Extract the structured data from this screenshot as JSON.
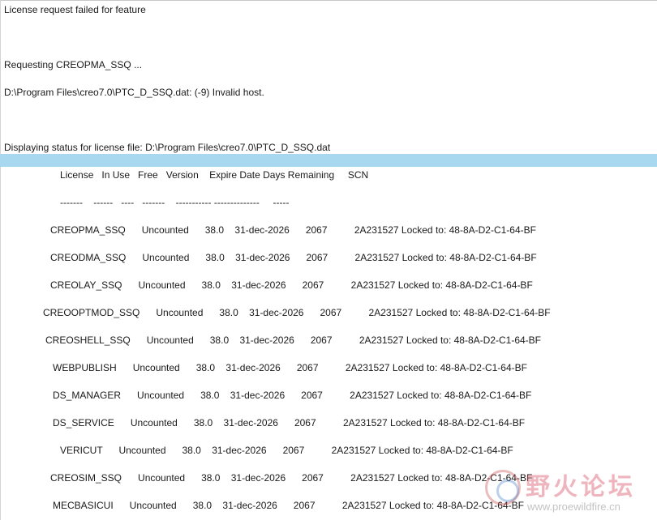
{
  "log": {
    "line1": "License request failed for feature",
    "line2": "Requesting CREOPMA_SSQ ...",
    "line3": "D:\\Program Files\\creo7.0\\PTC_D_SSQ.dat: (-9) Invalid host.",
    "line4": "Displaying status for license file: D:\\Program Files\\creo7.0\\PTC_D_SSQ.dat"
  },
  "table": {
    "header": "License   In Use   Free   Version    Expire Date Days Remaining     SCN",
    "separator": "-------    ------   ----   -------    ----------- --------------     -----",
    "rows": [
      "CREOPMA_SSQ      Uncounted      38.0    31-dec-2026      2067          2A231527 Locked to: 48-8A-D2-C1-64-BF",
      "CREODMA_SSQ      Uncounted      38.0    31-dec-2026      2067          2A231527 Locked to: 48-8A-D2-C1-64-BF",
      "CREOLAY_SSQ      Uncounted      38.0    31-dec-2026      2067          2A231527 Locked to: 48-8A-D2-C1-64-BF",
      "CREOOPTMOD_SSQ      Uncounted      38.0    31-dec-2026      2067          2A231527 Locked to: 48-8A-D2-C1-64-BF",
      "CREOSHELL_SSQ      Uncounted      38.0    31-dec-2026      2067          2A231527 Locked to: 48-8A-D2-C1-64-BF",
      "WEBPUBLISH      Uncounted      38.0    31-dec-2026      2067          2A231527 Locked to: 48-8A-D2-C1-64-BF",
      "DS_MANAGER      Uncounted      38.0    31-dec-2026      2067          2A231527 Locked to: 48-8A-D2-C1-64-BF",
      "DS_SERVICE      Uncounted      38.0    31-dec-2026      2067          2A231527 Locked to: 48-8A-D2-C1-64-BF",
      "VERICUT      Uncounted      38.0    31-dec-2026      2067          2A231527 Locked to: 48-8A-D2-C1-64-BF",
      "CREOSIM_SSQ      Uncounted      38.0    31-dec-2026      2067          2A231527 Locked to: 48-8A-D2-C1-64-BF",
      "MECBASICUI      Uncounted      38.0    31-dec-2026      2067          2A231527 Locked to: 48-8A-D2-C1-64-BF"
    ]
  },
  "watermark": {
    "text": "野火论坛",
    "url": "www.proewildfire.cn"
  },
  "colors": {
    "highlight": "#a8d8f0"
  }
}
